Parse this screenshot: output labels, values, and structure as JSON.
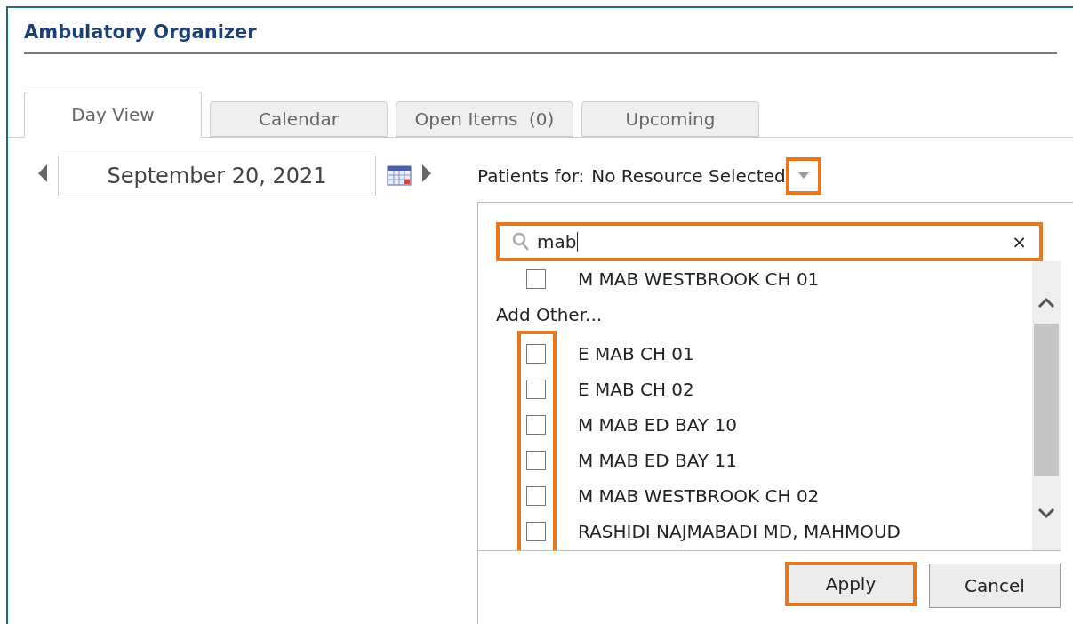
{
  "window": {
    "title": "Ambulatory Organizer"
  },
  "tabs": [
    {
      "label": "Day View",
      "selected": true
    },
    {
      "label": "Calendar",
      "selected": false
    },
    {
      "label": "Open Items  (0)",
      "selected": false
    },
    {
      "label": "Upcoming",
      "selected": false
    }
  ],
  "date": {
    "value": "September 20, 2021"
  },
  "patients_for": {
    "label": "Patients for:",
    "value": "No Resource Selected"
  },
  "search": {
    "value": "mab",
    "clear": "×"
  },
  "selected_items": [
    {
      "label": "M MAB WESTBROOK CH 01",
      "checked": false
    }
  ],
  "add_other": {
    "label": "Add Other...",
    "items": [
      {
        "label": "E MAB CH 01",
        "checked": false
      },
      {
        "label": "E MAB CH 02",
        "checked": false
      },
      {
        "label": "M MAB ED BAY 10",
        "checked": false
      },
      {
        "label": "M MAB ED BAY 11",
        "checked": false
      },
      {
        "label": "M MAB WESTBROOK CH 02",
        "checked": false
      },
      {
        "label": "RASHIDI NAJMABADI MD, MAHMOUD",
        "checked": false
      }
    ]
  },
  "buttons": [
    {
      "label": "Apply",
      "highlighted": true
    },
    {
      "label": "Cancel",
      "highlighted": false
    }
  ]
}
